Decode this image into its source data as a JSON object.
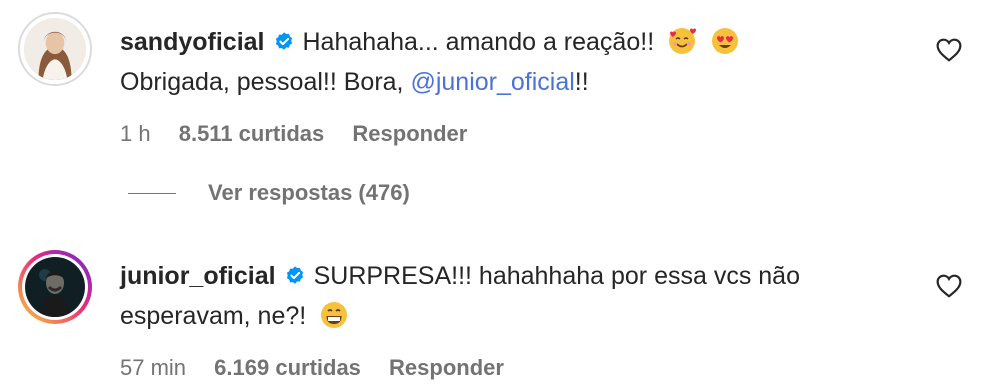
{
  "comments": [
    {
      "username": "sandyoficial",
      "text_before": "Hahahaha... amando a reação!!",
      "text_line2": "Obrigada, pessoal!! Bora, ",
      "mention": "@junior_oficial",
      "text_after": "!!",
      "emoji1": "smiling-face-with-hearts-emoji",
      "emoji2": "heart-eyes-emoji",
      "time": "1 h",
      "likes": "8.511 curtidas",
      "reply_label": "Responder"
    },
    {
      "username": "junior_oficial",
      "text": "SURPRESA!!! hahahhaha por essa vcs não esperavam, ne?!",
      "emoji": "grinning-face-emoji",
      "time": "57 min",
      "likes": "6.169 curtidas",
      "reply_label": "Responder"
    }
  ],
  "view_replies": "Ver respostas (476)",
  "colors": {
    "text": "#262626",
    "muted": "#737373",
    "mention": "#4b72d6",
    "verified": "#0095f6"
  }
}
